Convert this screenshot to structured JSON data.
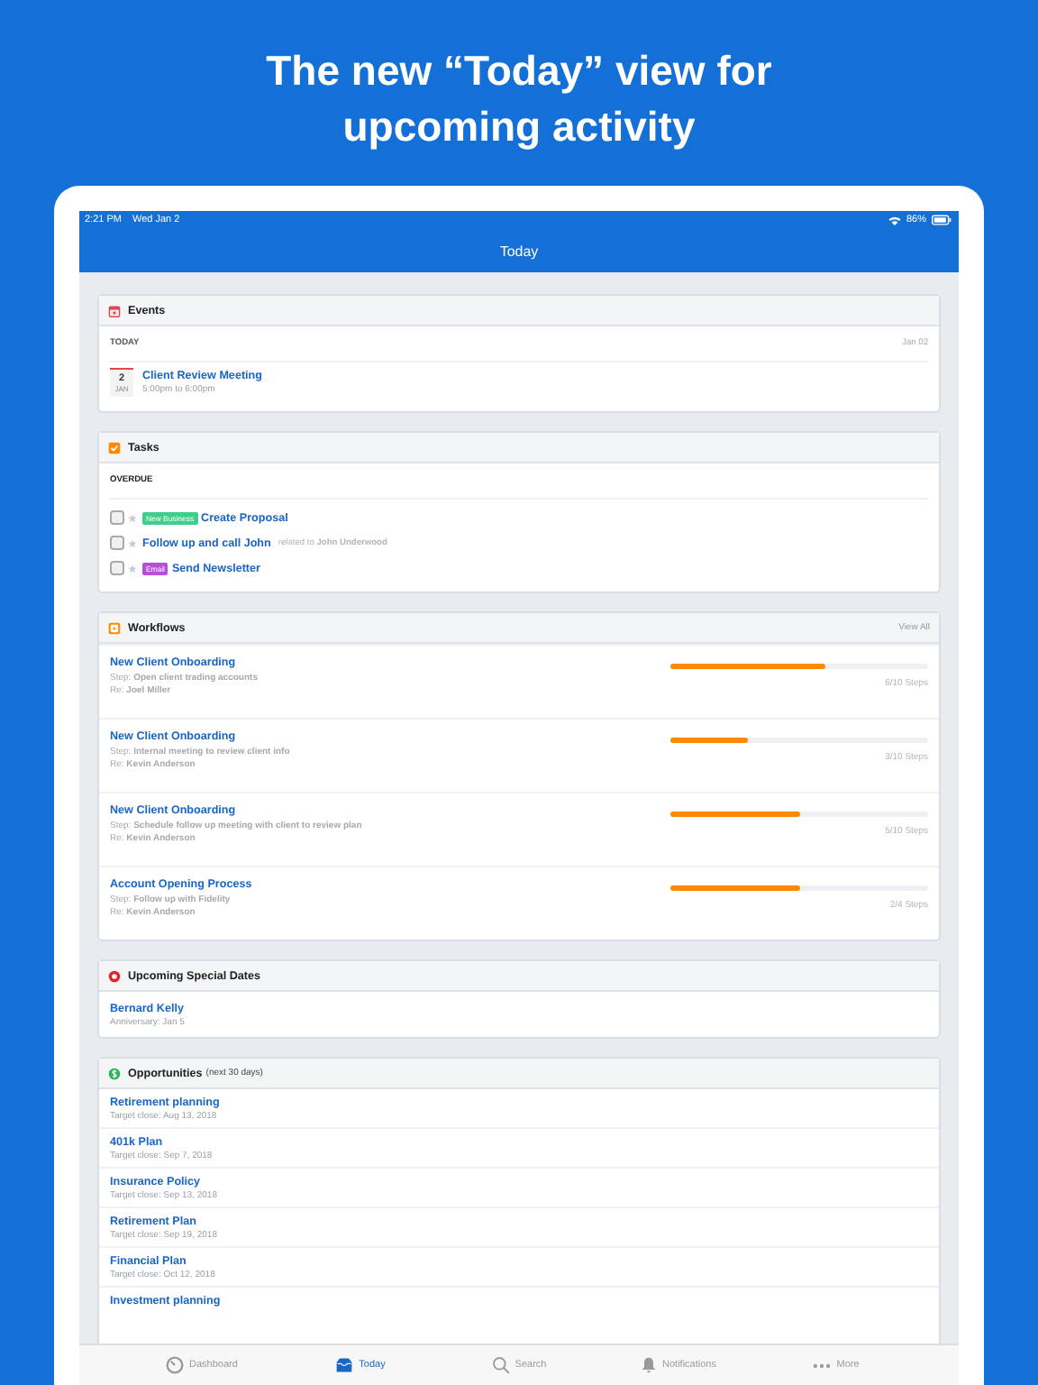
{
  "headline": "The new “Today” view for upcoming activity",
  "status_bar": {
    "time": "2:21 PM",
    "date": "Wed Jan 2",
    "battery": "86%"
  },
  "nav": {
    "title": "Today"
  },
  "events": {
    "title": "Events",
    "group": "TODAY",
    "date": "Jan 02",
    "items": [
      {
        "day": "2",
        "month": "JAN",
        "title": "Client Review Meeting",
        "time": "5:00pm to 6:00pm"
      }
    ]
  },
  "tasks": {
    "title": "Tasks",
    "group": "OVERDUE",
    "items": [
      {
        "checked": false,
        "tag": {
          "label": "New Business",
          "color": "#3fcf8a"
        },
        "title": "Create Proposal"
      },
      {
        "checked": false,
        "title": "Follow up and call John",
        "related": "related to **John Underwood**"
      },
      {
        "checked": false,
        "tag": {
          "label": "Email",
          "color": "#b84fd8"
        },
        "title": "Send Newsletter"
      }
    ]
  },
  "workflows": {
    "title": "Workflows",
    "link": "View All",
    "items": [
      {
        "title": "New Client Onboarding",
        "step": "Step: **Open client trading accounts**",
        "re": "Re: **Joel Miller**",
        "level": 0.6,
        "steps": "6/10 Steps"
      },
      {
        "title": "New Client Onboarding",
        "step": "Step: **Internal meeting to review client info**",
        "re": "Re: **Kevin Anderson**",
        "level": 0.3,
        "steps": "3/10 Steps"
      },
      {
        "title": "New Client Onboarding",
        "step": "Step: **Schedule follow up meeting with client to review plan**",
        "re": "Re: **Kevin Anderson**",
        "level": 0.5,
        "steps": "5/10 Steps"
      },
      {
        "title": "Account Opening Process",
        "step": "Step: **Follow up with Fidelity**",
        "re": "Re: **Kevin Anderson**",
        "level": 0.5,
        "steps": "2/4 Steps"
      }
    ]
  },
  "special_dates": {
    "title": "Upcoming Special Dates",
    "items": [
      {
        "name": "Bernard Kelly",
        "detail": "Anniversary: Jan 5"
      }
    ]
  },
  "opportunities": {
    "title": "Opportunities",
    "note": "(next 30 days)",
    "items": [
      {
        "title": "Retirement planning",
        "detail": "Target close: Aug 13, 2018"
      },
      {
        "title": "401k Plan",
        "detail": "Target close: Sep 7, 2018"
      },
      {
        "title": "Insurance Policy",
        "detail": "Target close: Sep 13, 2018"
      },
      {
        "title": "Retirement Plan",
        "detail": "Target close: Sep 19, 2018"
      },
      {
        "title": "Financial Plan",
        "detail": "Target close: Oct 12, 2018"
      },
      {
        "title": "Investment planning"
      }
    ]
  },
  "tab_bar": [
    {
      "kind": "dashboard",
      "label": "Dashboard",
      "selected": false
    },
    {
      "kind": "today",
      "label": "Today",
      "selected": true
    },
    {
      "kind": "search",
      "label": "Search",
      "selected": false
    },
    {
      "kind": "notifications",
      "label": "Notifications",
      "selected": false
    },
    {
      "kind": "more",
      "label": "More",
      "selected": false
    }
  ]
}
